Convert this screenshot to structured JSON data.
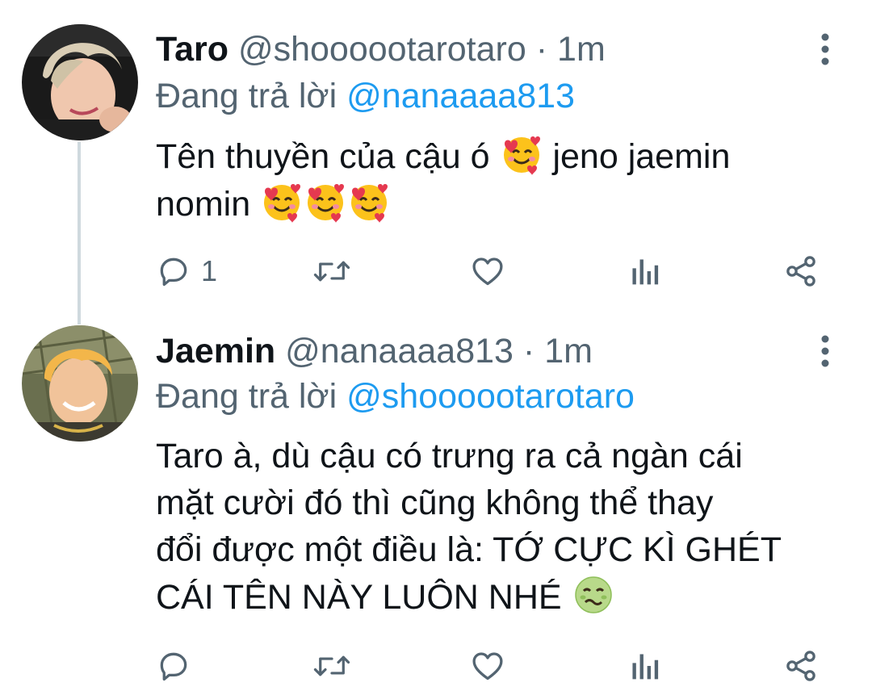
{
  "tweets": [
    {
      "display_name": "Taro",
      "handle": "@shoooootarotaro",
      "separator": "·",
      "time": "1m",
      "reply_prefix": "Đang trả lời",
      "reply_to": "@nanaaaa813",
      "text_1": "Tên thuyền của cậu ó",
      "text_2": "jeno jaemin",
      "text_3": "nomin",
      "emoji": "smiling-face-with-hearts",
      "reply_count": "1"
    },
    {
      "display_name": "Jaemin",
      "handle": "@nanaaaa813",
      "separator": "·",
      "time": "1m",
      "reply_prefix": "Đang trả lời",
      "reply_to": "@shoooootarotaro",
      "line_1": "Taro à, dù cậu có trưng ra cả ngàn cái",
      "line_2": "mặt cười đó thì cũng không thể thay",
      "line_3": "đổi được một điều là: TỚ CỰC KÌ GHÉT",
      "line_4": "CÁI TÊN NÀY LUÔN NHÉ",
      "emoji": "nauseated-face",
      "reply_count": ""
    }
  ],
  "colors": {
    "text": "#0f1419",
    "secondary": "#536471",
    "link": "#1d9bf0",
    "thread_line": "#cfd9de"
  },
  "icons": [
    "more-vertical-icon",
    "reply-icon",
    "retweet-icon",
    "like-icon",
    "analytics-icon",
    "share-icon"
  ]
}
